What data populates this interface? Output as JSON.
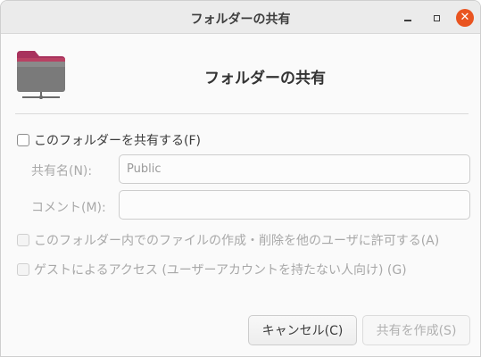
{
  "window": {
    "title": "フォルダーの共有",
    "buttons": {
      "minimize_icon": "minimize-icon",
      "maximize_icon": "maximize-icon",
      "close_icon": "close-icon",
      "close_glyph": "✕"
    }
  },
  "header": {
    "icon": "folder-share-icon",
    "title": "フォルダーの共有"
  },
  "share_checkbox": {
    "label": "このフォルダーを共有する(F)",
    "checked": false
  },
  "fields": {
    "share_name": {
      "label": "共有名(N):",
      "value": "Public"
    },
    "comment": {
      "label": "コメント(M):",
      "value": ""
    }
  },
  "options": {
    "allow_others": {
      "label": "このフォルダー内でのファイルの作成・削除を他のユーザに許可する(A)",
      "checked": false,
      "enabled": false
    },
    "guest_access": {
      "label": "ゲストによるアクセス (ユーザーアカウントを持たない人向け) (G)",
      "checked": false,
      "enabled": false
    }
  },
  "actions": {
    "cancel": "キャンセル(C)",
    "create": "共有を作成(S)"
  },
  "colors": {
    "close_button": "#e95420",
    "folder_top": "#a8325d",
    "folder_body": "#7a7a7a"
  }
}
